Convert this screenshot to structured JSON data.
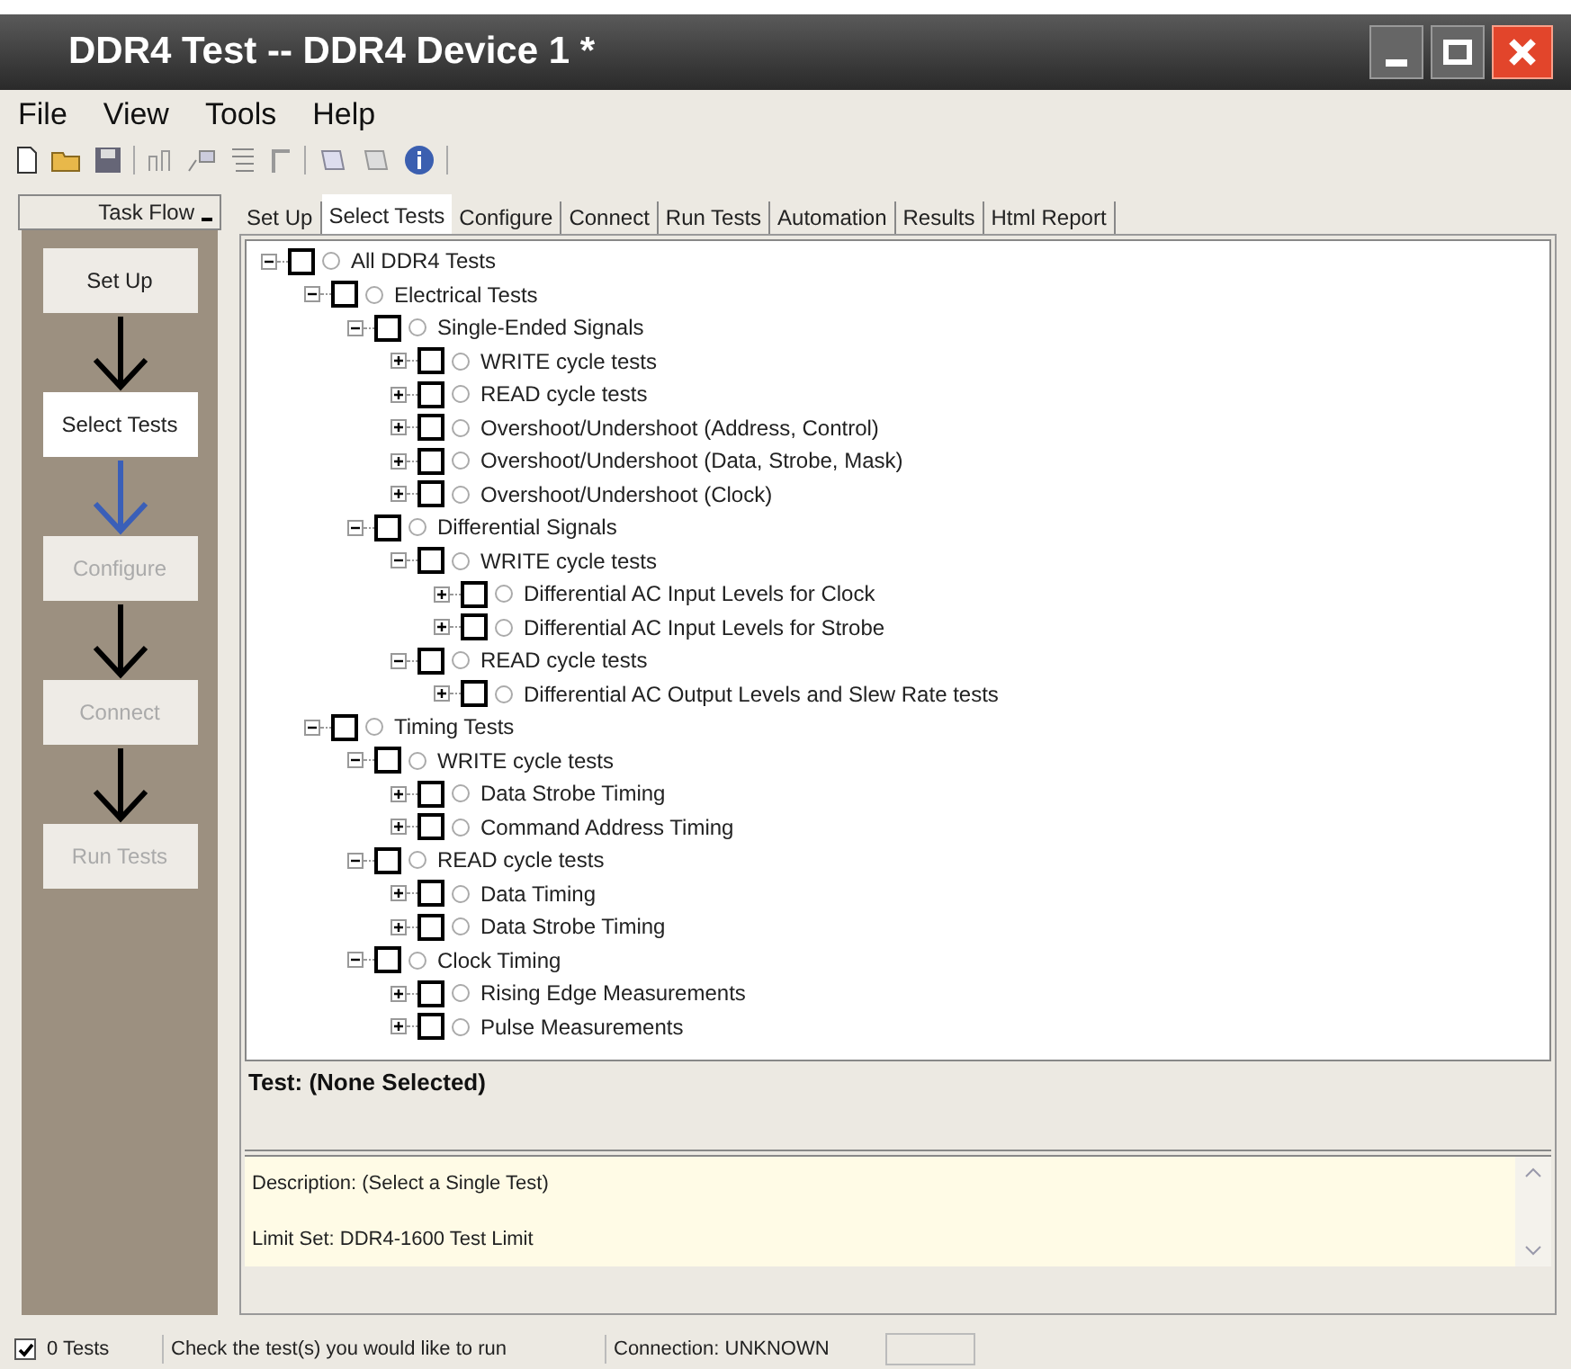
{
  "window": {
    "title": "DDR4 Test -- DDR4 Device 1 *"
  },
  "menu": [
    "File",
    "View",
    "Tools",
    "Help"
  ],
  "task_flow": {
    "title": "Task Flow",
    "steps": [
      {
        "label": "Set Up",
        "selected": false,
        "disabled": false
      },
      {
        "label": "Select Tests",
        "selected": true,
        "disabled": false
      },
      {
        "label": "Configure",
        "selected": false,
        "disabled": true
      },
      {
        "label": "Connect",
        "selected": false,
        "disabled": true
      },
      {
        "label": "Run Tests",
        "selected": false,
        "disabled": true
      }
    ]
  },
  "tabs": [
    {
      "label": "Set Up",
      "selected": false
    },
    {
      "label": "Select Tests",
      "selected": true
    },
    {
      "label": "Configure",
      "selected": false
    },
    {
      "label": "Connect",
      "selected": false
    },
    {
      "label": "Run Tests",
      "selected": false
    },
    {
      "label": "Automation",
      "selected": false
    },
    {
      "label": "Results",
      "selected": false
    },
    {
      "label": "Html Report",
      "selected": false
    }
  ],
  "tree": [
    {
      "label": "All DDR4 Tests",
      "expanded": true,
      "checked": false,
      "children": [
        {
          "label": "Electrical Tests",
          "expanded": true,
          "checked": false,
          "children": [
            {
              "label": "Single-Ended Signals",
              "expanded": true,
              "checked": false,
              "children": [
                {
                  "label": "WRITE cycle tests",
                  "expanded": false,
                  "checked": false
                },
                {
                  "label": "READ cycle tests",
                  "expanded": false,
                  "checked": false
                },
                {
                  "label": "Overshoot/Undershoot (Address, Control)",
                  "expanded": false,
                  "checked": false
                },
                {
                  "label": "Overshoot/Undershoot (Data, Strobe, Mask)",
                  "expanded": false,
                  "checked": false
                },
                {
                  "label": "Overshoot/Undershoot (Clock)",
                  "expanded": false,
                  "checked": false
                }
              ]
            },
            {
              "label": "Differential Signals",
              "expanded": true,
              "checked": false,
              "children": [
                {
                  "label": "WRITE cycle tests",
                  "expanded": true,
                  "checked": false,
                  "children": [
                    {
                      "label": "Differential AC Input Levels for Clock",
                      "expanded": false,
                      "checked": false
                    },
                    {
                      "label": "Differential AC Input Levels for Strobe",
                      "expanded": false,
                      "checked": false
                    }
                  ]
                },
                {
                  "label": "READ cycle tests",
                  "expanded": true,
                  "checked": false,
                  "children": [
                    {
                      "label": "Differential AC Output Levels and Slew Rate tests",
                      "expanded": false,
                      "checked": false
                    }
                  ]
                }
              ]
            }
          ]
        },
        {
          "label": "Timing Tests",
          "expanded": true,
          "checked": false,
          "children": [
            {
              "label": "WRITE cycle tests",
              "expanded": true,
              "checked": false,
              "children": [
                {
                  "label": "Data Strobe Timing",
                  "expanded": false,
                  "checked": false
                },
                {
                  "label": "Command Address Timing",
                  "expanded": false,
                  "checked": false
                }
              ]
            },
            {
              "label": "READ cycle tests",
              "expanded": true,
              "checked": false,
              "children": [
                {
                  "label": "Data Timing",
                  "expanded": false,
                  "checked": false
                },
                {
                  "label": "Data Strobe Timing",
                  "expanded": false,
                  "checked": false
                }
              ]
            },
            {
              "label": "Clock Timing",
              "expanded": true,
              "checked": false,
              "children": [
                {
                  "label": "Rising Edge Measurements",
                  "expanded": false,
                  "checked": false
                },
                {
                  "label": "Pulse Measurements",
                  "expanded": false,
                  "checked": false
                }
              ]
            }
          ]
        }
      ]
    }
  ],
  "test_panel": {
    "title": "Test: (None Selected)"
  },
  "description": {
    "lines": [
      "Description: (Select a Single Test)",
      "Limit Set: DDR4-1600 Test Limit"
    ]
  },
  "status_bar": {
    "checked": true,
    "count": "0 Tests",
    "message": "Check the test(s) you would like to run",
    "connection": "Connection: UNKNOWN"
  }
}
